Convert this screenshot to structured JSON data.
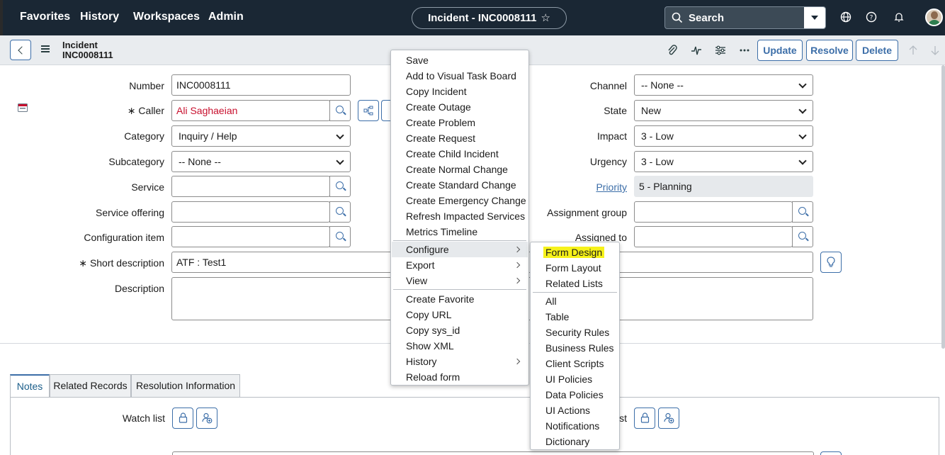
{
  "topnav": {
    "links": [
      "Favorites",
      "History",
      "Workspaces",
      "Admin"
    ],
    "record_pill": "Incident - INC0008111",
    "search_label": "Search"
  },
  "header": {
    "title_line1": "Incident",
    "title_line2": "INC0008111",
    "update": "Update",
    "resolve": "Resolve",
    "delete": "Delete"
  },
  "form": {
    "number_label": "Number",
    "number_value": "INC0008111",
    "caller_label": "Caller",
    "caller_value": "Ali Saghaeian",
    "category_label": "Category",
    "category_value": "Inquiry / Help",
    "subcategory_label": "Subcategory",
    "subcategory_value": "-- None --",
    "service_label": "Service",
    "service_value": "",
    "service_offering_label": "Service offering",
    "service_offering_value": "",
    "config_item_label": "Configuration item",
    "config_item_value": "",
    "short_desc_label": "Short description",
    "short_desc_value": "ATF : Test1",
    "description_label": "Description",
    "channel_label": "Channel",
    "channel_value": "-- None --",
    "state_label": "State",
    "state_value": "New",
    "impact_label": "Impact",
    "impact_value": "3 - Low",
    "urgency_label": "Urgency",
    "urgency_value": "3 - Low",
    "priority_label": "Priority",
    "priority_value": "5 - Planning",
    "assignment_group_label": "Assignment group",
    "assignment_group_value": "",
    "assigned_to_label": "Assigned to",
    "assigned_to_value": "",
    "required_mark": "∗"
  },
  "tabs": [
    "Notes",
    "Related Records",
    "Resolution Information"
  ],
  "notes": {
    "watch_list_label": "Watch list",
    "right_label_partial": "st"
  },
  "context_menu": {
    "items": [
      "Save",
      "Add to Visual Task Board",
      "Copy Incident",
      "Create Outage",
      "Create Problem",
      "Create Request",
      "Create Child Incident",
      "Create Normal Change",
      "Create Standard Change",
      "Create Emergency Change",
      "Refresh Impacted Services",
      "Metrics Timeline"
    ],
    "group2": [
      "Configure",
      "Export",
      "View"
    ],
    "group3": [
      "Create Favorite",
      "Copy URL",
      "Copy sys_id",
      "Show XML",
      "History",
      "Reload form"
    ]
  },
  "configure_submenu": {
    "items1": [
      "Form Design",
      "Form Layout",
      "Related Lists"
    ],
    "items2": [
      "All",
      "Table",
      "Security Rules",
      "Business Rules",
      "Client Scripts",
      "UI Policies",
      "Data Policies",
      "UI Actions",
      "Notifications",
      "Dictionary"
    ],
    "highlight_color": "#f6f21a"
  },
  "colors": {
    "nav_bg": "#1a2734",
    "accent": "#3c6ea8",
    "caller_red": "#c8102e"
  }
}
